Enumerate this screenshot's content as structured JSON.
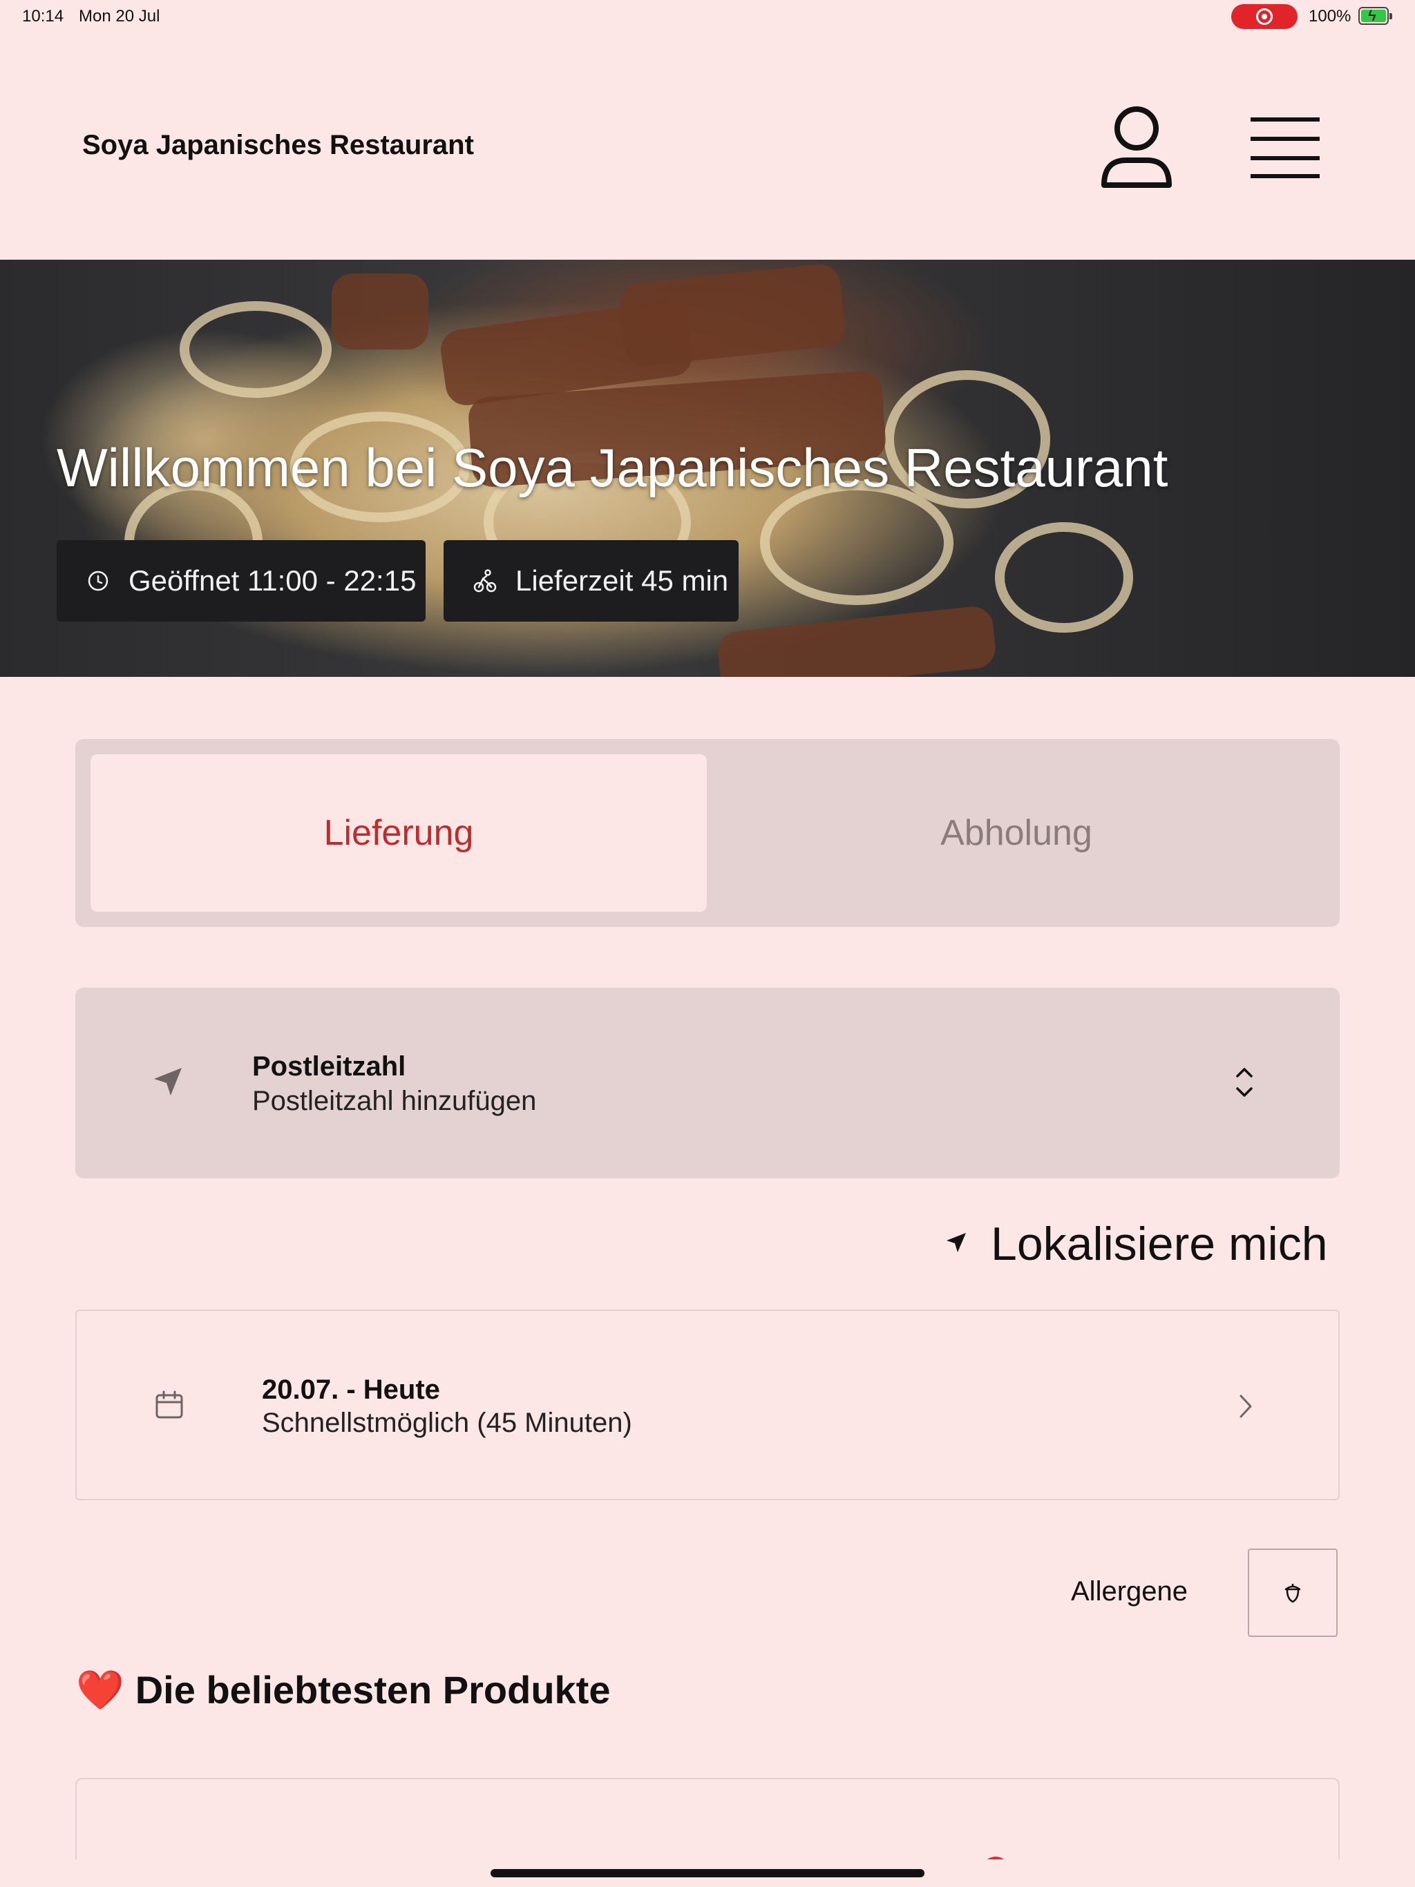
{
  "status_bar": {
    "time": "10:14",
    "date": "Mon 20 Jul",
    "battery": "100%",
    "recording_color": "#e0242a",
    "battery_color": "#33c748"
  },
  "header": {
    "title": "Soya Japanisches Restaurant",
    "account_icon": "user-icon",
    "menu_icon": "hamburger-menu-icon"
  },
  "hero": {
    "welcome": "Willkommen bei Soya Japanisches Restaurant",
    "opening_hours": "Geöffnet 11:00 - 22:15",
    "delivery_time": "Lieferzeit 45 min",
    "opening_icon": "clock-icon",
    "delivery_icon": "bicycle-icon"
  },
  "order_type": {
    "tabs": [
      {
        "label": "Lieferung",
        "selected": true
      },
      {
        "label": "Abholung",
        "selected": false
      }
    ],
    "selected_color": "#c22b2b"
  },
  "postcode": {
    "title": "Postleitzahl",
    "placeholder": "Postleitzahl hinzufügen",
    "icon": "location-arrow-icon",
    "expand_icon": "chevron-up-down-icon"
  },
  "locate": {
    "label": "Lokalisiere mich",
    "icon": "location-arrow-icon"
  },
  "schedule": {
    "title": "20.07. - Heute",
    "subtitle": "Schnellstmöglich (45 Minuten)",
    "icon": "calendar-icon",
    "chevron": "chevron-right-icon"
  },
  "allergens": {
    "label": "Allergene",
    "icon": "acorn-icon"
  },
  "popular": {
    "emoji": "❤️",
    "heading": "Die beliebtesten Produkte"
  }
}
